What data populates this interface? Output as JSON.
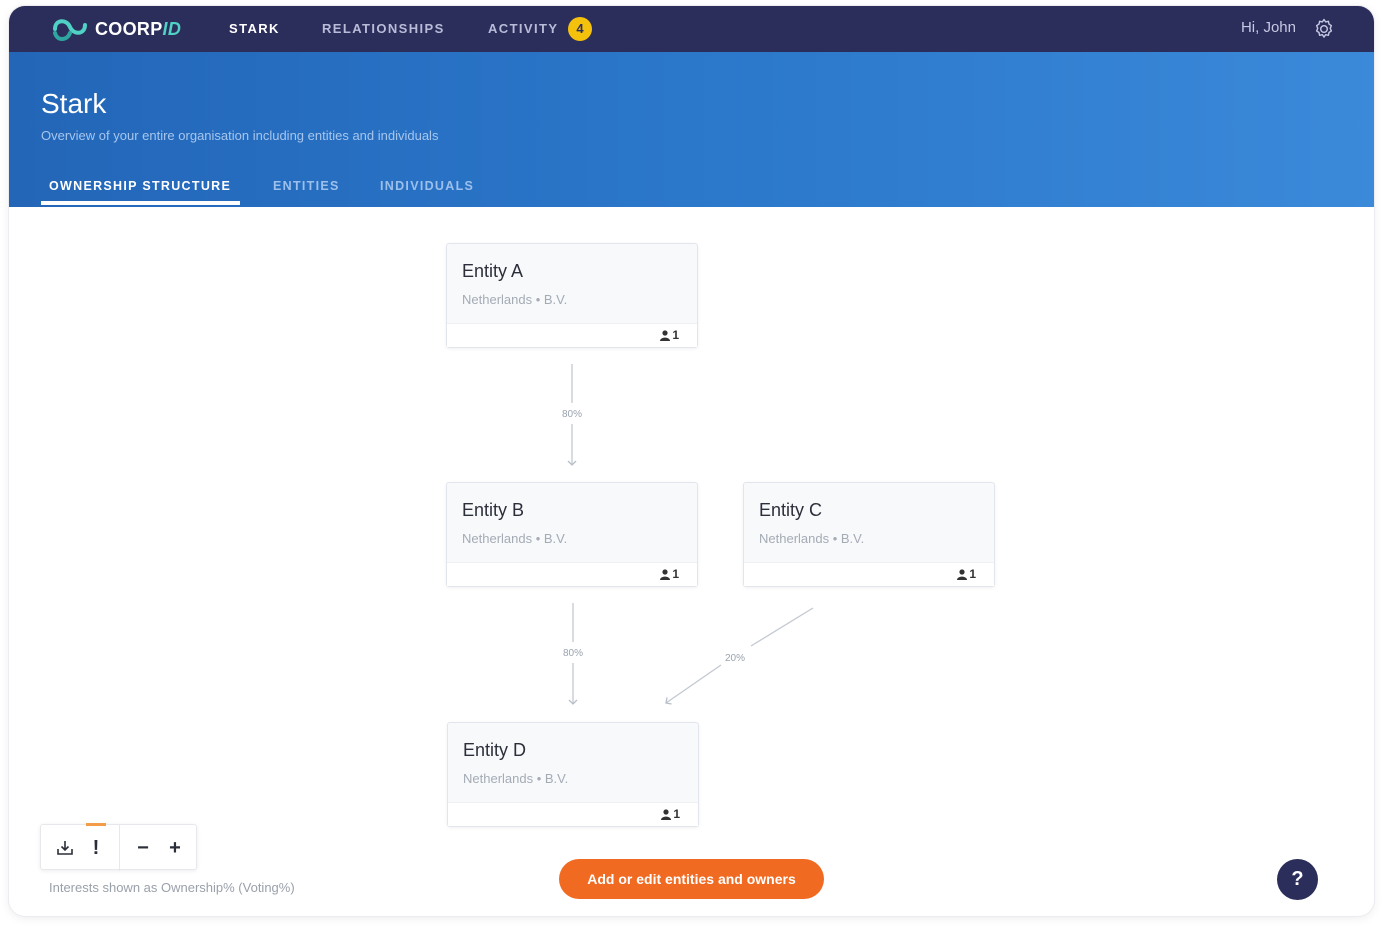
{
  "app": {
    "logo_main": "COORP",
    "logo_accent": "ID"
  },
  "nav": {
    "items": [
      {
        "label": "STARK"
      },
      {
        "label": "RELATIONSHIPS"
      },
      {
        "label": "ACTIVITY"
      }
    ],
    "activity_badge": "4",
    "greeting": "Hi, John"
  },
  "header": {
    "title": "Stark",
    "subtitle": "Overview of your entire organisation including entities and individuals",
    "tabs": [
      {
        "label": "OWNERSHIP STRUCTURE"
      },
      {
        "label": "ENTITIES"
      },
      {
        "label": "INDIVIDUALS"
      }
    ]
  },
  "entities": [
    {
      "name": "Entity A",
      "meta": "Netherlands • B.V.",
      "count": "1"
    },
    {
      "name": "Entity B",
      "meta": "Netherlands • B.V.",
      "count": "1"
    },
    {
      "name": "Entity C",
      "meta": "Netherlands • B.V.",
      "count": "1"
    },
    {
      "name": "Entity D",
      "meta": "Netherlands • B.V.",
      "count": "1"
    }
  ],
  "links": [
    {
      "from": "Entity A",
      "to": "Entity B",
      "label": "80%"
    },
    {
      "from": "Entity B",
      "to": "Entity D",
      "label": "80%"
    },
    {
      "from": "Entity C",
      "to": "Entity D",
      "label": "20%"
    }
  ],
  "controls": {
    "zoom_out": "−",
    "zoom_in": "+",
    "alert": "!"
  },
  "legend_note": "Interests shown as Ownership% (Voting%)",
  "cta_label": "Add or edit entities and owners",
  "help_label": "?",
  "colors": {
    "nav_bg": "#2b2d5a",
    "hero_start": "#2366b8",
    "hero_end": "#3b89d9",
    "cta": "#f16a21",
    "badge": "#f4c20d",
    "accent": "#4fd1c5"
  }
}
